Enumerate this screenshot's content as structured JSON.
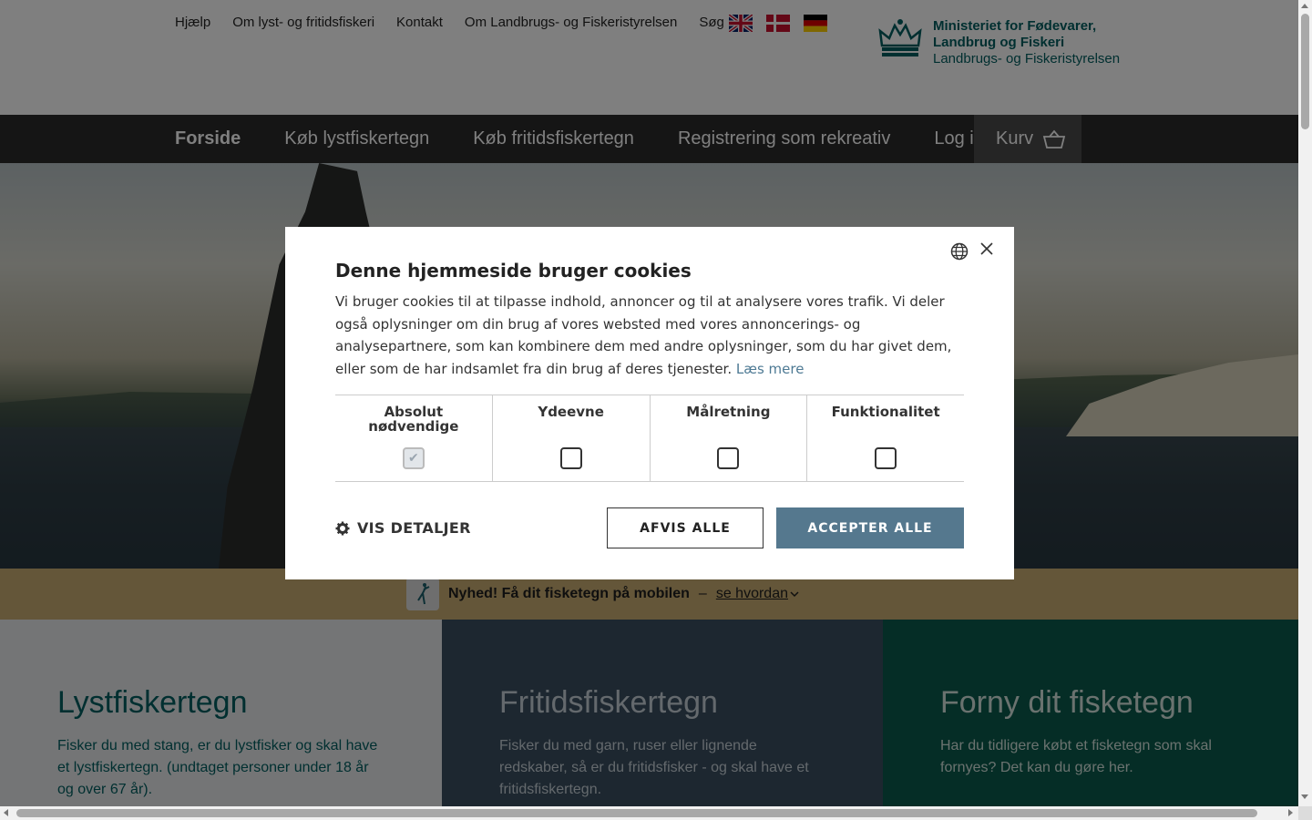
{
  "header": {
    "top_links": [
      "Hjælp",
      "Om lyst- og fritidsfiskeri",
      "Kontakt",
      "Om Landbrugs- og Fiskeristyrelsen",
      "Søg"
    ],
    "flags": [
      "english-flag-icon",
      "danish-flag-icon",
      "german-flag-icon"
    ],
    "logo": {
      "line1": "Ministeriet for Fødevarer,",
      "line2": "Landbrug og Fiskeri",
      "line3": "Landbrugs- og Fiskeristyrelsen",
      "icon": "crown-icon"
    }
  },
  "nav": {
    "items": [
      "Forside",
      "Køb lystfiskertegn",
      "Køb fritidsfiskertegn",
      "Registrering som rekreativ",
      "Log ind"
    ],
    "cart_label": "Kurv"
  },
  "banner": {
    "text": "Nyhed! Få dit fisketegn på mobilen",
    "separator": "–",
    "link": "se hvordan"
  },
  "cards": [
    {
      "title": "Lystfiskertegn",
      "text": "Fisker du med stang, er du lystfisker og skal have et lystfiskertegn. (undtaget personer under 18 år og over 67 år)."
    },
    {
      "title": "Fritidsfiskertegn",
      "text": "Fisker du med garn, ruser eller lignende redskaber, så er du fritidsfisker - og skal have et fritidsfiskertegn."
    },
    {
      "title": "Forny dit fisketegn",
      "text": "Har du tidligere købt et fisketegn som skal fornyes? Det kan du gøre her."
    }
  ],
  "cookie_dialog": {
    "title": "Denne hjemmeside bruger cookies",
    "description": "Vi bruger cookies til at tilpasse indhold, annoncer og til at analysere vores trafik. Vi deler også oplysninger om din brug af vores websted med vores annoncerings- og analysepartnere, som kan kombinere dem med andre oplysninger, som du har givet dem, eller som de har indsamlet fra din brug af deres tjenester.",
    "read_more": "Læs mere",
    "categories": [
      {
        "label_line1": "Absolut",
        "label_line2": "nødvendige",
        "checked": true,
        "disabled": true
      },
      {
        "label_line1": "Ydeevne",
        "label_line2": "",
        "checked": false,
        "disabled": false
      },
      {
        "label_line1": "Målretning",
        "label_line2": "",
        "checked": false,
        "disabled": false
      },
      {
        "label_line1": "Funktionalitet",
        "label_line2": "",
        "checked": false,
        "disabled": false
      }
    ],
    "details_label": "VIS DETALJER",
    "reject_label": "AFVIS ALLE",
    "accept_label": "ACCEPTER ALLE"
  },
  "colors": {
    "brand_teal": "#005e60",
    "accept_button": "#55788e",
    "nav_bg": "#2b2b2b",
    "banner_bg": "#c9ad73"
  }
}
